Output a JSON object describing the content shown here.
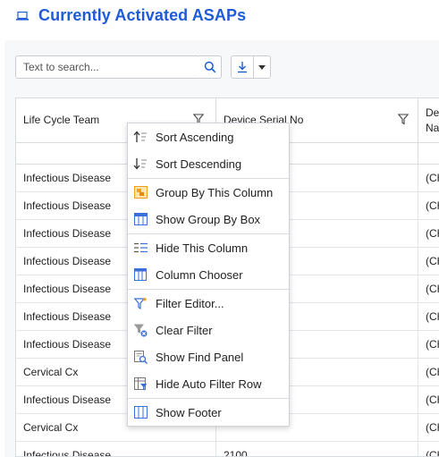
{
  "header": {
    "title": "Currently Activated ASAPs"
  },
  "toolbar": {
    "search_placeholder": "Text to search..."
  },
  "grid": {
    "columns": [
      "Life Cycle Team",
      "Device Serial No",
      "Dev Nar"
    ],
    "rows": [
      [
        "Infectious Disease",
        "",
        "(CH"
      ],
      [
        "Infectious Disease",
        "",
        "(CH"
      ],
      [
        "Infectious Disease",
        "",
        "(CH"
      ],
      [
        "Infectious Disease",
        "",
        "(CH"
      ],
      [
        "Infectious Disease",
        "",
        "(CH"
      ],
      [
        "Infectious Disease",
        "",
        "(CH"
      ],
      [
        "Infectious Disease",
        "",
        "(CH"
      ],
      [
        "Cervical Cx",
        "",
        "(CH"
      ],
      [
        "Infectious Disease",
        "",
        "(CH"
      ],
      [
        "Cervical Cx",
        "",
        "(CH"
      ],
      [
        "Infectious Disease",
        "2100",
        "(CH"
      ]
    ]
  },
  "context_menu": {
    "items": [
      {
        "label": "Sort Ascending",
        "icon": "sort-ascending-icon"
      },
      {
        "label": "Sort Descending",
        "icon": "sort-descending-icon"
      },
      {
        "label": "Group By This Column",
        "icon": "group-by-column-icon"
      },
      {
        "label": "Show Group By Box",
        "icon": "group-by-box-icon"
      },
      {
        "label": "Hide This Column",
        "icon": "hide-column-icon"
      },
      {
        "label": "Column Chooser",
        "icon": "column-chooser-icon"
      },
      {
        "label": "Filter Editor...",
        "icon": "filter-editor-icon"
      },
      {
        "label": "Clear Filter",
        "icon": "clear-filter-icon"
      },
      {
        "label": "Show Find Panel",
        "icon": "find-panel-icon"
      },
      {
        "label": "Hide Auto Filter Row",
        "icon": "auto-filter-row-icon"
      },
      {
        "label": "Show Footer",
        "icon": "footer-icon"
      }
    ]
  },
  "colors": {
    "accent": "#1f5bd6",
    "menu_icon_orange": "#f0a020",
    "menu_icon_blue": "#3a6fd8"
  }
}
